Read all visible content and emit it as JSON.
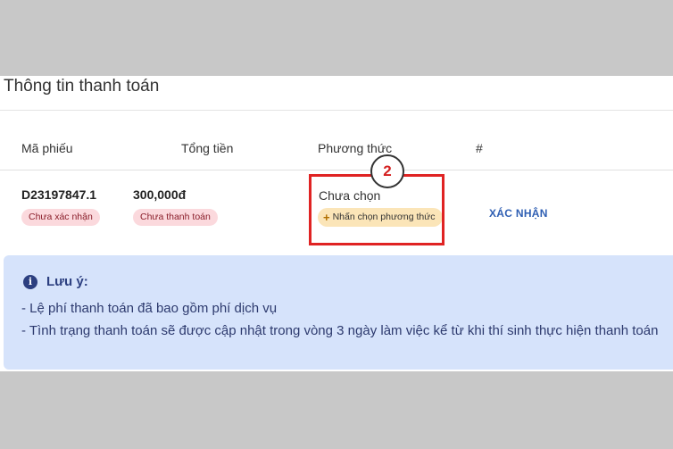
{
  "page": {
    "title": "Thông tin thanh toán"
  },
  "table": {
    "headers": [
      "Mã phiếu",
      "Tổng tiền",
      "Phương thức",
      "#"
    ],
    "row": {
      "code": "D23197847.1",
      "code_badge": "Chưa xác nhận",
      "amount": "300,000đ",
      "amount_badge": "Chưa thanh toán",
      "method_status": "Chưa chọn",
      "method_button": "Nhấn chọn phương thức",
      "action": "XÁC NHẬN"
    }
  },
  "annotation": {
    "step": "2"
  },
  "note": {
    "title": "Lưu ý:",
    "lines": [
      "- Lệ phí thanh toán đã bao gồm phí dịch vụ",
      "- Tình trạng thanh toán sẽ được cập nhật trong vòng 3 ngày làm việc kể từ khi thí sinh thực hiện thanh toán"
    ]
  },
  "colors": {
    "highlight": "#e02323",
    "link": "#2f5fb3",
    "note_bg": "#d6e3fb",
    "badge_bg": "#fbd9dd",
    "button_bg": "#fbe5b8"
  },
  "icons": {
    "info": "info-circle-icon",
    "plus": "plus-icon"
  }
}
